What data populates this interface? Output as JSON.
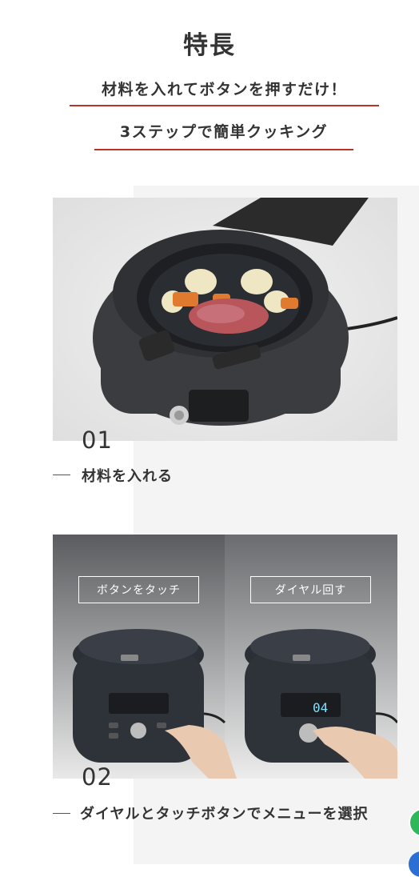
{
  "heading": "特長",
  "subheading_1": "材料を入れてボタンを押すだけ！",
  "subheading_2": "3ステップで簡単クッキング",
  "steps": [
    {
      "number": "01",
      "caption": "材料を入れる"
    },
    {
      "number": "02",
      "caption": "ダイヤルとタッチボタンでメニューを選択"
    }
  ],
  "step2_tags": [
    "ボタンをタッチ",
    "ダイヤル回す"
  ],
  "display_readout": "04",
  "colors": {
    "accent_underline": "#b8322a",
    "text": "#333333",
    "panel_bg": "#f4f4f4"
  }
}
